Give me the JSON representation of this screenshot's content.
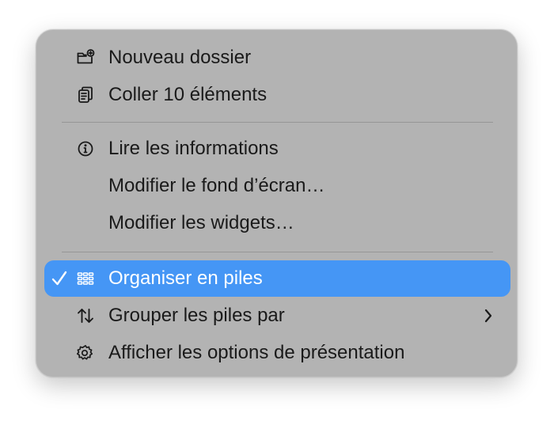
{
  "menu": {
    "items": [
      {
        "label": "Nouveau dossier",
        "icon": "folder-badge-plus-icon"
      },
      {
        "label": "Coller 10 éléments",
        "icon": "doc-on-clipboard-icon"
      },
      {
        "label": "Lire les informations",
        "icon": "info-circle-icon"
      },
      {
        "label": "Modifier le fond d’écran…"
      },
      {
        "label": "Modifier les widgets…"
      },
      {
        "label": "Organiser en piles",
        "icon": "square-grid-icon",
        "checked": true,
        "selected": true
      },
      {
        "label": "Grouper les piles par",
        "icon": "arrow-up-arrow-down-icon",
        "submenu": true
      },
      {
        "label": "Afficher les options de présentation",
        "icon": "gear-icon"
      }
    ]
  },
  "colors": {
    "menu_background": "#b3b3b3",
    "selection": "#4596f5",
    "text": "#1a1a1a",
    "selected_text": "#ffffff",
    "separator": "#969696"
  }
}
